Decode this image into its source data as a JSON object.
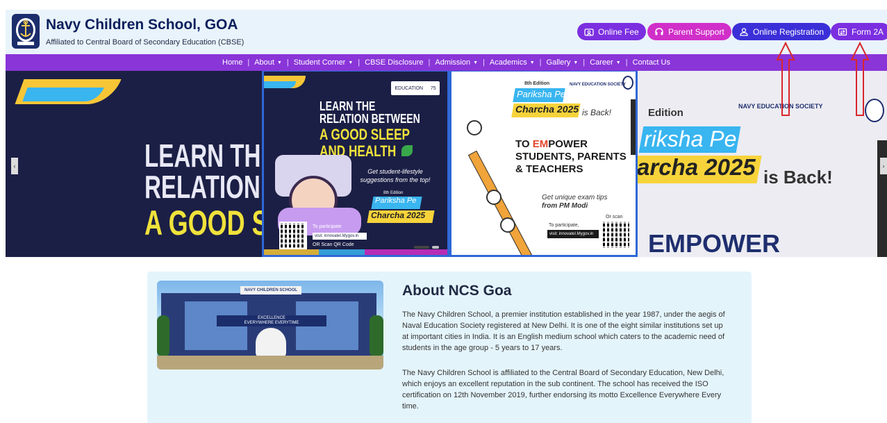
{
  "header": {
    "title": "Navy Children School, GOA",
    "subtitle": "Affiliated to Central Board of Secondary Education (CBSE)",
    "buttons": {
      "online_fee": "Online Fee",
      "parent_support": "Parent Support",
      "online_registration": "Online Registration",
      "form_2a": "Form 2A"
    }
  },
  "nav": {
    "items": [
      {
        "label": "Home",
        "dropdown": false
      },
      {
        "label": "About",
        "dropdown": true
      },
      {
        "label": "Student Corner",
        "dropdown": true
      },
      {
        "label": "CBSE Disclosure",
        "dropdown": false
      },
      {
        "label": "Admission",
        "dropdown": true
      },
      {
        "label": "Academics",
        "dropdown": true
      },
      {
        "label": "Gallery",
        "dropdown": true
      },
      {
        "label": "Career",
        "dropdown": true
      },
      {
        "label": "Contact Us",
        "dropdown": false
      }
    ],
    "separator": "|",
    "caret": "▼"
  },
  "carousel": {
    "prev": "‹",
    "next": "›",
    "background_left": {
      "line1": "LEARN THE",
      "line2": "RELATION B",
      "line3": "A GOOD S"
    },
    "background_right": {
      "edition": "Edition",
      "society": "NAVY EDUCATION SOCIETY",
      "pariksha": "riksha Pe",
      "charcha": "archa 2025",
      "back": "is Back!",
      "empower": "EMPOWER"
    },
    "slide_a": {
      "edu_badge_left": "EDUCATION",
      "edu_badge_right": "75",
      "line1": "LEARN THE",
      "line2": "RELATION BETWEEN",
      "line3": "A GOOD SLEEP",
      "line4": "AND HEALTH",
      "tagline": "Get student-lifestyle suggestions from the top!",
      "edition": "8th Edition",
      "pariksha": "Pariksha Pe",
      "charcha": "Charcha 2025",
      "participate": "To participate",
      "visit": "visit: innovateI.Mygov.in",
      "or_scan": "OR Scan QR Code"
    },
    "slide_b": {
      "society": "NAVY EDUCATION SOCIETY",
      "edition": "8th Edition",
      "pariksha": "Pariksha Pe",
      "charcha": "Charcha 2025",
      "back": "is Back!",
      "to": "TO ",
      "empower_em": "EM",
      "empower_rest": "POWER",
      "students_parents": "STUDENTS, PARENTS",
      "teachers": "& TEACHERS",
      "tips1": "Get unique exam tips",
      "tips2": "from PM Modi",
      "participate": "To participate,",
      "visit": "visit: innovateI.Mygov.in",
      "or_scan": "Or scan"
    }
  },
  "about": {
    "title": "About NCS Goa",
    "photo_sign": "NAVY CHILDREN SCHOOL",
    "photo_banner_1": "EXCELLENCE",
    "photo_banner_2": "EVERYWHERE EVERYTIME",
    "paragraph1": "The Navy Children School, a premier institution established in the year 1987, under the aegis of Naval Education Society registered at New Delhi. It is one of the eight similar institutions set up at important cities in India. It is an English medium school which caters to the academic need of students in the age group - 5 years to 17 years.",
    "paragraph2": "The Navy Children School is affiliated to the Central Board of Secondary Education, New Delhi, which enjoys an excellent reputation in the sub continent. The school has received the ISO certification on 12th November 2019, further endorsing its motto Excellence Everywhere Every time."
  },
  "colors": {
    "nav_bg": "#8a35d8",
    "header_bg": "#e9f3fb",
    "online_fee": "#7b2fe0",
    "parent_support": "#d12fc9",
    "online_registration": "#3b2fd8",
    "form_2a": "#7b2fe0",
    "annotation_arrow": "#d8262c",
    "about_bg": "#e4f4fb"
  },
  "icons": {
    "logo": "navy-anchor-crest-icon",
    "online_fee": "id-card-icon",
    "parent_support": "headset-icon",
    "online_registration": "user-register-icon",
    "form_2a": "form-exchange-icon"
  }
}
